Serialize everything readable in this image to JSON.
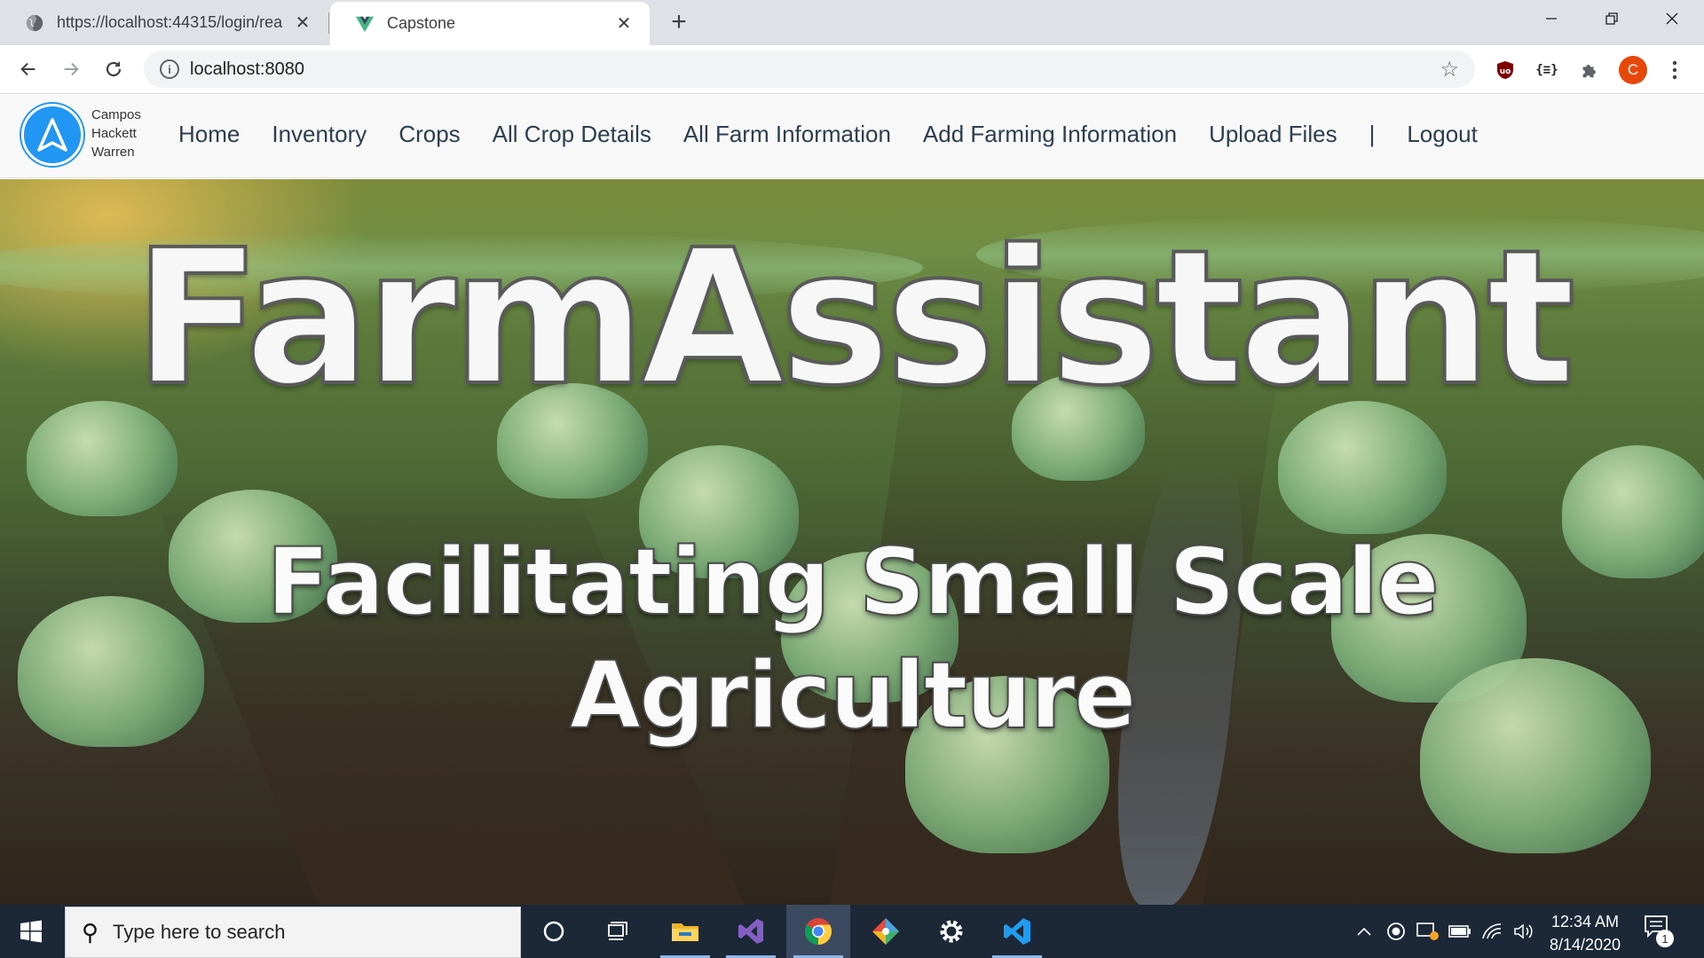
{
  "browser": {
    "tabs": [
      {
        "title": "https://localhost:44315/login/rea",
        "icon": "globe-icon",
        "active": false
      },
      {
        "title": "Capstone",
        "icon": "vue-logo-icon",
        "active": true
      }
    ],
    "new_tab_icon": "plus-icon",
    "address": "localhost:8080",
    "window_controls": [
      "minimize-icon",
      "restore-icon",
      "close-icon"
    ],
    "extensions": [
      "ublock-icon",
      "json-viewer-icon",
      "puzzle-icon"
    ],
    "profile_initial": "C",
    "profile_color": "#e8470a"
  },
  "site": {
    "brand_names": [
      "Campos",
      "Hackett",
      "Warren"
    ],
    "logo_color": "#2196f3",
    "nav": [
      "Home",
      "Inventory",
      "Crops",
      "All Crop Details",
      "All Farm Information",
      "Add Farming Information",
      "Upload Files"
    ],
    "nav_separator": "|",
    "logout": "Logout"
  },
  "hero": {
    "title": "FarmAssistant",
    "subtitle": "Facilitating Small Scale Agriculture"
  },
  "taskbar": {
    "search_placeholder": "Type here to search",
    "apps": [
      "cortana-icon",
      "task-view-icon",
      "file-explorer-icon",
      "visual-studio-icon",
      "chrome-icon",
      "git-tool-icon",
      "settings-icon",
      "vscode-icon"
    ],
    "time": "12:34 AM",
    "date": "8/14/2020",
    "notification_count": "1"
  }
}
